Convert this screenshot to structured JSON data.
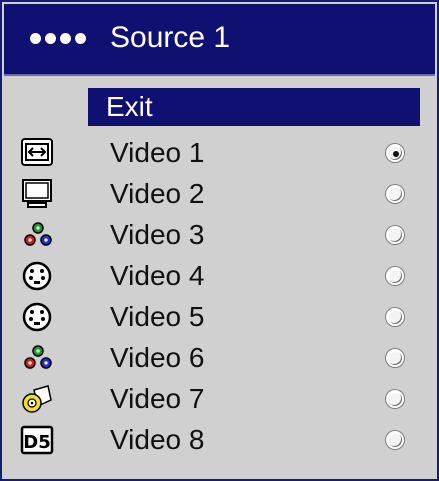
{
  "menu": {
    "title": "Source 1",
    "exit_label": "Exit",
    "items": [
      {
        "label": "Video 1",
        "icon": "computer-port-icon",
        "selected": true
      },
      {
        "label": "Video 2",
        "icon": "monitor-icon",
        "selected": false
      },
      {
        "label": "Video 3",
        "icon": "component-rgb-icon",
        "selected": false
      },
      {
        "label": "Video 4",
        "icon": "svideo-icon",
        "selected": false
      },
      {
        "label": "Video 5",
        "icon": "svideo-icon",
        "selected": false
      },
      {
        "label": "Video 6",
        "icon": "component-rgb-icon",
        "selected": false
      },
      {
        "label": "Video 7",
        "icon": "composite-video-icon",
        "selected": false
      },
      {
        "label": "Video 8",
        "icon": "d5-icon",
        "selected": false
      }
    ]
  },
  "colors": {
    "title_bar": "#101073",
    "panel_bg": "#cfd0cf",
    "highlight": "#101073"
  }
}
